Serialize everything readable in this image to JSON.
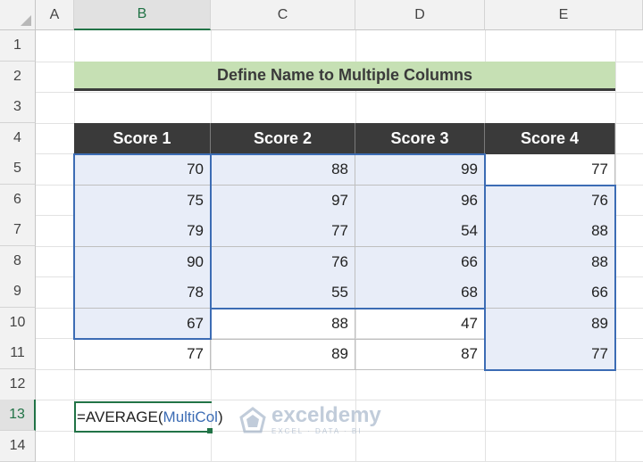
{
  "sheet": {
    "columns": [
      "A",
      "B",
      "C",
      "D",
      "E"
    ],
    "rows": [
      "1",
      "2",
      "3",
      "4",
      "5",
      "6",
      "7",
      "8",
      "9",
      "10",
      "11",
      "12",
      "13",
      "14"
    ],
    "active_column": "B",
    "active_row": "13"
  },
  "title": "Define Name to Multiple Columns",
  "table": {
    "headers": [
      "Score 1",
      "Score 2",
      "Score 3",
      "Score 4"
    ],
    "rows": [
      [
        "70",
        "88",
        "99",
        "77"
      ],
      [
        "75",
        "97",
        "96",
        "76"
      ],
      [
        "79",
        "77",
        "54",
        "88"
      ],
      [
        "90",
        "76",
        "66",
        "88"
      ],
      [
        "78",
        "55",
        "68",
        "66"
      ],
      [
        "67",
        "88",
        "47",
        "89"
      ],
      [
        "77",
        "89",
        "87",
        "77"
      ]
    ]
  },
  "formula": {
    "prefix": "=AVERAGE(",
    "reference": "MultiCol",
    "suffix": ")"
  },
  "watermark": {
    "name": "exceldemy",
    "tagline": "EXCEL · DATA · BI"
  },
  "colors": {
    "accent_green": "#217346",
    "selection_blue": "#3c6cb4",
    "title_fill": "#c6e0b4",
    "header_fill": "#3a3a3a",
    "highlight_fill": "#e8edf8"
  }
}
